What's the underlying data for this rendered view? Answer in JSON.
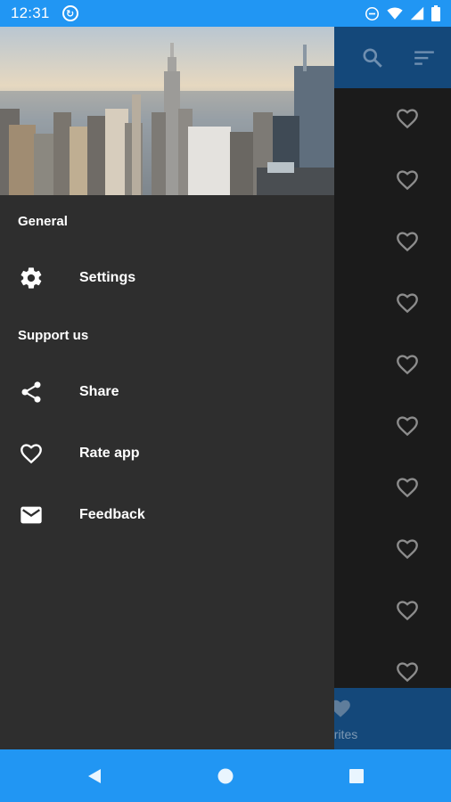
{
  "status_bar": {
    "time": "12:31",
    "app_icon": "sync-icon",
    "icons": [
      "do-not-disturb-icon",
      "wifi-icon",
      "signal-icon",
      "battery-icon"
    ],
    "color": "#2196f3"
  },
  "drawer": {
    "header_image": "city-skyline-image",
    "sections": [
      {
        "title": "General",
        "items": [
          {
            "label": "Settings",
            "icon": "gear-icon"
          }
        ]
      },
      {
        "title": "Support us",
        "items": [
          {
            "label": "Share",
            "icon": "share-icon"
          },
          {
            "label": "Rate app",
            "icon": "heart-outline-icon"
          },
          {
            "label": "Feedback",
            "icon": "mail-icon"
          }
        ]
      }
    ],
    "background": "#2e2e2e"
  },
  "app_behind": {
    "toolbar_icons": [
      "search-icon",
      "sort-icon"
    ],
    "list_item_icon": "heart-outline-icon",
    "list_item_count": 10,
    "bottom_nav": {
      "label": "orites",
      "icon": "heart-filled-icon"
    }
  },
  "system_nav": {
    "buttons": [
      "back-icon",
      "home-icon",
      "recents-icon"
    ],
    "color": "#2196f3"
  }
}
